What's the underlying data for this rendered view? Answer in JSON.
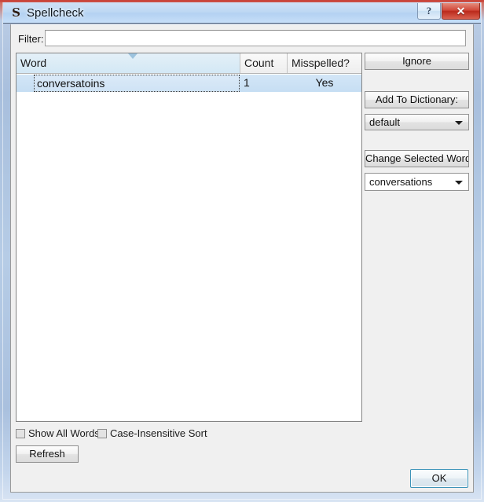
{
  "window": {
    "title": "Spellcheck",
    "icon": "spellcheck-s-icon",
    "icon_glyph": "S",
    "help_label": "?",
    "close_label": "✕"
  },
  "filter": {
    "label": "Filter:",
    "value": "",
    "placeholder": ""
  },
  "table": {
    "sort_column": "Word",
    "sort_direction": "descending",
    "columns": [
      {
        "label": "Word"
      },
      {
        "label": "Count"
      },
      {
        "label": "Misspelled?"
      }
    ],
    "rows": [
      {
        "word": "conversatoins",
        "count": "1",
        "misspelled": "Yes",
        "selected": true,
        "editing": true
      }
    ]
  },
  "actions": {
    "ignore_label": "Ignore",
    "add_to_dictionary_label": "Add To Dictionary:",
    "dictionary_value": "default",
    "change_selected_word_label": "Change Selected Word To:",
    "replacement_value": "conversations"
  },
  "options": {
    "show_all_words_label": "Show All Words",
    "show_all_words_checked": false,
    "case_insensitive_sort_label": "Case-Insensitive Sort",
    "case_insensitive_sort_checked": false,
    "refresh_label": "Refresh"
  },
  "footer": {
    "ok_label": "OK"
  },
  "colors": {
    "title_bar": "#bed8f3",
    "frame_accent": "#c9443a",
    "close_button": "#d2483a",
    "selection": "#c6def3",
    "sorted_header": "#d3e8f5",
    "ok_focus_border": "#3c93b8",
    "dialog_background": "#f0f0f0"
  }
}
